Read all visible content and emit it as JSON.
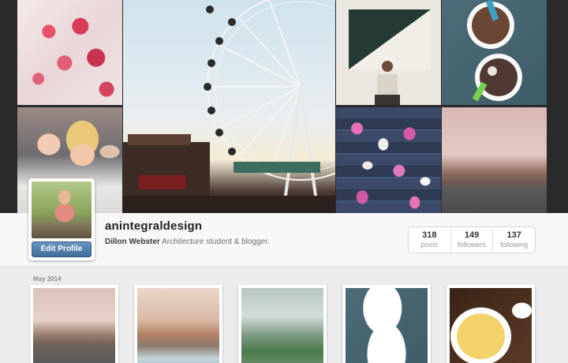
{
  "profile": {
    "username": "anintegraldesign",
    "full_name": "Dillon Webster",
    "bio": "Architecture student & blogger.",
    "edit_label": "Edit Profile"
  },
  "stats": [
    {
      "value": "318",
      "label": "posts"
    },
    {
      "value": "149",
      "label": "followers"
    },
    {
      "value": "137",
      "label": "following"
    }
  ],
  "feed": {
    "month_label": "May 2014"
  },
  "colors": {
    "accent_button": "#4a77a3",
    "page_bg": "#ececec",
    "banner_bg": "#2a2a2a"
  }
}
